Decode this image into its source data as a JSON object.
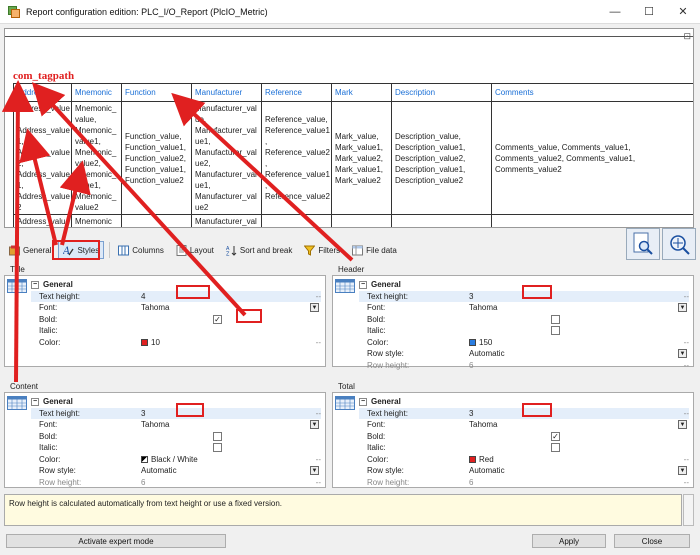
{
  "window": {
    "title": "Report configuration edition: PLC_I/O_Report (PlcIO_Metric)",
    "minimize": "—",
    "maximize": "☐",
    "close": "✕"
  },
  "preview": {
    "tagpath": "com_tagpath",
    "headers": [
      "Address",
      "Mnemonic",
      "Function",
      "Manufacturer",
      "Reference",
      "Mark",
      "Description",
      "Comments"
    ],
    "row1": [
      "Address_value\n,\nAddress_value\n1,\nAddress_value\n2,\nAddress_value\n1,\nAddress_value\n2",
      "Mnemonic_\nvalue,\nMnemonic_\nvalue1,\nMnemonic_\nvalue2,\nMnemonic_\nvalue1,\nMnemonic_\nvalue2",
      "Function_value,\nFunction_value1,\nFunction_value2,\nFunction_value1,\nFunction_value2",
      "Manufacturer_val\nue,\nManufacturer_val\nue1,\nManufacturer_val\nue2,\nManufacturer_val\nue1,\nManufacturer_val\nue2",
      "Reference_value,\nReference_value1\n,\nReference_value2\n,\nReference_value1\n,\nReference_value2",
      "Mark_value,\nMark_value1,\nMark_value2,\nMark_value1,\nMark_value2",
      "Description_value,\nDescription_value1,\nDescription_value2,\nDescription_value1,\nDescription_value2",
      "Comments_value, Comments_value1,\nComments_value2, Comments_value1,\nComments_value2"
    ],
    "row2": [
      "Address_value",
      "Mnemonic",
      "",
      "Manufacturer_val",
      "",
      "",
      "",
      ""
    ]
  },
  "toolbar": {
    "tabs": [
      {
        "label": "General",
        "icon": "general-icon"
      },
      {
        "label": "Styles",
        "icon": "styles-icon"
      },
      {
        "label": "Columns",
        "icon": "columns-icon"
      },
      {
        "label": "Layout",
        "icon": "layout-icon"
      },
      {
        "label": "Sort and break",
        "icon": "sort-icon"
      },
      {
        "label": "Filters",
        "icon": "filter-icon"
      },
      {
        "label": "File data",
        "icon": "file-data-icon"
      }
    ],
    "active_tab": "Styles"
  },
  "panels": {
    "title": {
      "label": "Title",
      "group": "General",
      "text_height_label": "Text height:",
      "text_height": "4",
      "font_label": "Font:",
      "font": "Tahoma",
      "bold_label": "Bold:",
      "bold": true,
      "italic_label": "Italic:",
      "italic": false,
      "color_label": "Color:",
      "color": "10",
      "color_hex": "#e02020"
    },
    "header": {
      "label": "Header",
      "group": "General",
      "text_height_label": "Text height:",
      "text_height": "3",
      "font_label": "Font:",
      "font": "Tahoma",
      "bold_label": "Bold:",
      "bold": false,
      "italic_label": "Italic:",
      "italic": false,
      "color_label": "Color:",
      "color": "150",
      "color_hex": "#2a7de1",
      "row_style_label": "Row style:",
      "row_style": "Automatic",
      "row_height_label": "Row height:",
      "row_height": "6"
    },
    "content": {
      "label": "Content",
      "group": "General",
      "text_height_label": "Text height:",
      "text_height": "3",
      "font_label": "Font:",
      "font": "Tahoma",
      "bold_label": "Bold:",
      "bold": false,
      "italic_label": "Italic:",
      "italic": false,
      "color_label": "Color:",
      "color": "Black / White",
      "color_hex": "#000000",
      "row_style_label": "Row style:",
      "row_style": "Automatic",
      "row_height_label": "Row height:",
      "row_height": "6"
    },
    "total": {
      "label": "Total",
      "group": "General",
      "text_height_label": "Text height:",
      "text_height": "3",
      "font_label": "Font:",
      "font": "Tahoma",
      "bold_label": "Bold:",
      "bold": true,
      "italic_label": "Italic:",
      "italic": false,
      "color_label": "Color:",
      "color": "Red",
      "color_hex": "#e02020",
      "row_style_label": "Row style:",
      "row_style": "Automatic",
      "row_height_label": "Row height:",
      "row_height": "6"
    }
  },
  "hint": "Row height is calculated automatically from text height or use a fixed version.",
  "buttons": {
    "expert": "Activate expert mode",
    "apply": "Apply",
    "close": "Close"
  },
  "colors": {
    "annotation_red": "#e02020",
    "header_blue": "#1a6fd6",
    "active_tab": "#dce9f8",
    "highlight_row": "#e4eefa"
  }
}
